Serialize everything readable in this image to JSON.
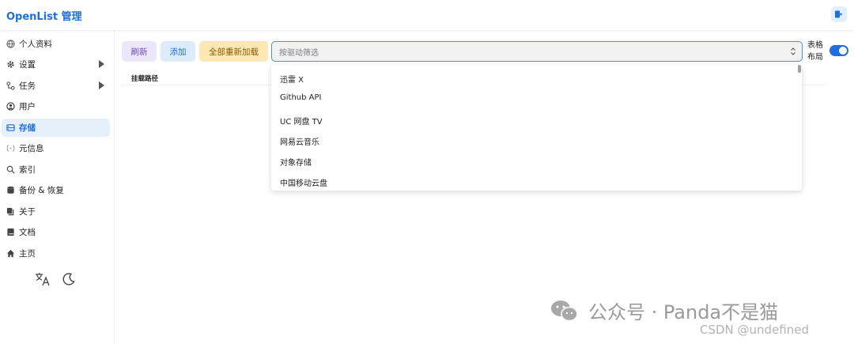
{
  "header": {
    "title": "OpenList 管理"
  },
  "sidebar": {
    "items": [
      {
        "label": "个人资料",
        "icon": "globe-icon"
      },
      {
        "label": "设置",
        "icon": "gear-icon",
        "expandable": true
      },
      {
        "label": "任务",
        "icon": "workflow-icon",
        "expandable": true
      },
      {
        "label": "用户",
        "icon": "user-circle-icon"
      },
      {
        "label": "存储",
        "icon": "storage-icon",
        "active": true
      },
      {
        "label": "元信息",
        "icon": "meta-icon"
      },
      {
        "label": "索引",
        "icon": "search-icon"
      },
      {
        "label": "备份 & 恢复",
        "icon": "database-icon"
      },
      {
        "label": "关于",
        "icon": "copy-icon"
      },
      {
        "label": "文档",
        "icon": "book-icon"
      },
      {
        "label": "主页",
        "icon": "home-icon"
      }
    ]
  },
  "toolbar": {
    "refresh_label": "刷新",
    "add_label": "添加",
    "reload_all_label": "全部重新加载",
    "filter_placeholder": "按驱动筛选",
    "layout_label_line1": "表格",
    "layout_label_line2": "布局",
    "table_layout_enabled": true
  },
  "table": {
    "columns": [
      "挂载路径"
    ]
  },
  "dropdown": {
    "options": [
      "迅雷 X",
      "Github API",
      "UC 网盘 TV",
      "网易云音乐",
      "对象存储",
      "中国移动云盘"
    ]
  },
  "watermark": {
    "main": "公众号 · Panda不是猫",
    "sub": "CSDN @undefined"
  },
  "colors": {
    "accent": "#1e6fd9",
    "active_bg": "#e6f0fb",
    "refresh_bg": "#ece6fb",
    "add_bg": "#dcecfd",
    "reload_bg": "#fde8b3"
  }
}
